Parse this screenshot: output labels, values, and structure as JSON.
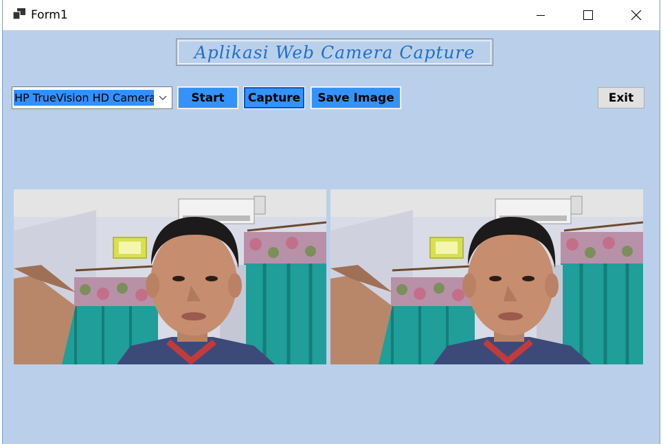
{
  "window": {
    "title": "Form1",
    "icons": {
      "app": "app-icon",
      "minimize": "minimize-icon",
      "maximize": "maximize-icon",
      "close": "close-icon"
    }
  },
  "header": {
    "title": "Aplikasi Web Camera Capture"
  },
  "camera_select": {
    "value": "HP TrueVision HD Camera",
    "icon": "chevron-down-icon"
  },
  "buttons": {
    "start": "Start",
    "capture": "Capture",
    "save": "Save Image",
    "exit": "Exit"
  },
  "previews": {
    "live": "live-camera-feed",
    "captured": "captured-image"
  },
  "colors": {
    "form_background": "#bad0ea",
    "button_blue": "#3493fa",
    "heading_text": "#1f6ecf"
  }
}
